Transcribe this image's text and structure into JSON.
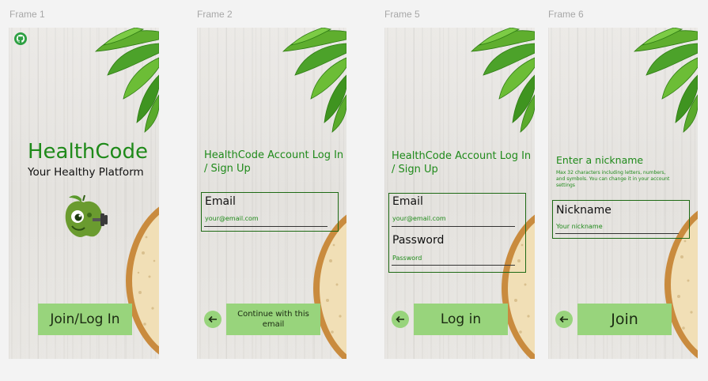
{
  "frames": [
    {
      "label": "Frame 1"
    },
    {
      "label": "Frame 2"
    },
    {
      "label": "Frame 5"
    },
    {
      "label": "Frame 6"
    }
  ],
  "frame1": {
    "app_name": "HealthCode",
    "tagline": "Your Healthy Platform",
    "github_icon": "github-icon",
    "mascot_icon": "apple-dumbbell-mascot-icon",
    "join_label": "Join/Log In"
  },
  "frame2": {
    "heading": "HealthCode Account Log In / Sign Up",
    "email_label": "Email",
    "email_placeholder": "your@email.com",
    "continue_label": "Continue with this email"
  },
  "frame5": {
    "heading": "HealthCode Account Log In / Sign Up",
    "email_label": "Email",
    "email_placeholder": "your@email.com",
    "password_label": "Password",
    "password_placeholder": "Password",
    "login_label": "Log in"
  },
  "frame6": {
    "heading": "Enter a nickname",
    "hint": "Max 32 characters including letters, numbers, and symbols. You can change it in your account settings",
    "nickname_label": "Nickname",
    "nickname_placeholder": "Your nickname",
    "join_label": "Join"
  },
  "colors": {
    "brand_green": "#1f8a1a",
    "button_green": "#98d47c",
    "outline_green": "#1e6a14"
  }
}
